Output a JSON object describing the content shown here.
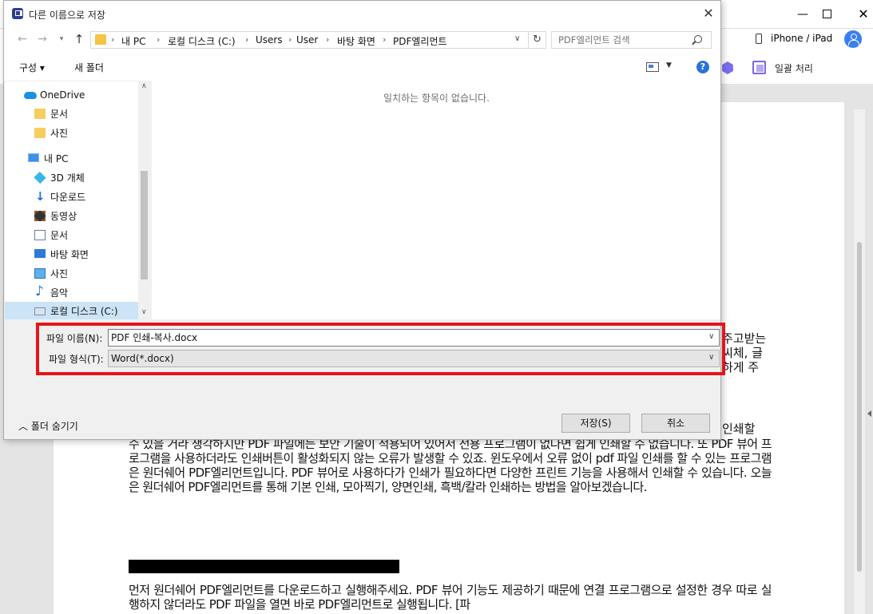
{
  "app": {
    "device_label": "iPhone / iPad",
    "batch_label": "일괄 처리"
  },
  "document": {
    "right_fragments": [
      "주고받는",
      "씨체, 글",
      "하게 주"
    ],
    "inline_fragment": "인쇄할",
    "para1": "수 있을 거라 생각하지만 PDF 파일에는 보안 기술이 적용되어 있어서 전용 프로그램이 없다면 쉽게 인쇄할 수 없습니다. 또 PDF 뷰어 프로그램을 사용하더라도 인쇄버튼이 활성화되지 않는 오류가 발생할 수 있죠. 윈도우에서 오류 없이 pdf 파일 인쇄를 할 수 있는 프로그램은 원더쉐어 PDF엘리먼트입니다. PDF 뷰어로 사용하다가 인쇄가 필요하다면 다양한 프린트 기능을 사용해서 인쇄할 수 있습니다. 오늘은 원더쉐어 PDF엘리먼트를 통해 기본 인쇄, 모아찍기, 양면인쇄, 흑백/칼라 인쇄하는 방법을 알아보겠습니다.",
    "para2": "먼저 원더쉐어 PDF엘리먼트를 다운로드하고 실행해주세요. PDF 뷰어 기능도 제공하기 때문에 연결 프로그램으로 설정한 경우 따로 실행하지 않더라도 PDF 파일을 열면 바로 PDF엘리먼트로 실행됩니다. [파"
  },
  "dialog": {
    "title": "다른 이름으로 저장",
    "breadcrumbs": [
      "내 PC",
      "로컬 디스크 (C:)",
      "Users",
      "User",
      "바탕 화면",
      "PDF엘리먼트"
    ],
    "search_placeholder": "PDF엘리먼트 검색",
    "organize_label": "구성 ▾",
    "new_folder_label": "새 폴더",
    "help_label": "?",
    "empty_message": "일치하는 항목이 없습니다.",
    "tree": [
      {
        "label": "OneDrive",
        "icon": "onedrive-icon"
      },
      {
        "label": "문서",
        "icon": "folder-icon"
      },
      {
        "label": "사진",
        "icon": "folder-icon"
      },
      {
        "label": "내 PC",
        "icon": "pc-icon"
      },
      {
        "label": "3D 개체",
        "icon": "3d-objects-icon"
      },
      {
        "label": "다운로드",
        "icon": "download-icon"
      },
      {
        "label": "동영상",
        "icon": "video-icon"
      },
      {
        "label": "문서",
        "icon": "document-icon"
      },
      {
        "label": "바탕 화면",
        "icon": "desktop-icon"
      },
      {
        "label": "사진",
        "icon": "pictures-icon"
      },
      {
        "label": "음악",
        "icon": "music-icon"
      },
      {
        "label": "로컬 디스크 (C:)",
        "icon": "disk-icon"
      }
    ],
    "filename_label": "파일 이름(N):",
    "filename_value": "PDF 인쇄-복사.docx",
    "filetype_label": "파일 형식(T):",
    "filetype_value": "Word(*.docx)",
    "hide_folders_label": "폴더 숨기기",
    "save_label": "저장(S)",
    "cancel_label": "취소"
  },
  "colors": {
    "highlight": "#e3151d",
    "accent": "#2a73d9",
    "selection": "#cce4f7"
  }
}
